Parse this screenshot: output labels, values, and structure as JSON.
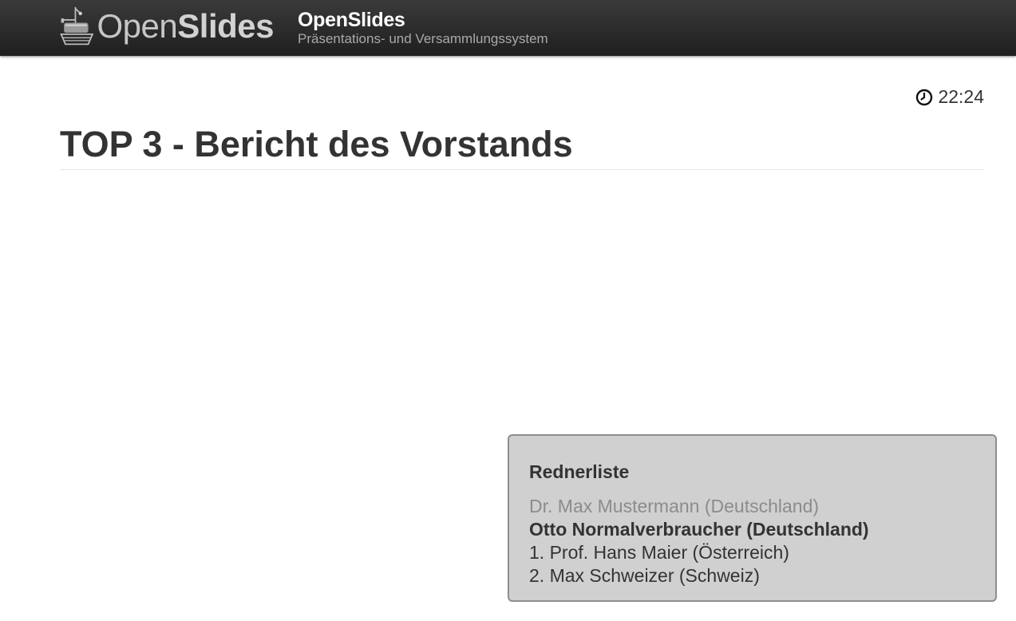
{
  "header": {
    "logo_text_light": "Open",
    "logo_text_bold": "Slides",
    "title": "OpenSlides",
    "subtitle": "Präsentations- und Versammlungssystem"
  },
  "clock": {
    "icon": "clock-icon",
    "time": "22:24"
  },
  "slide": {
    "title": "TOP 3 - Bericht des Vorstands"
  },
  "speakers": {
    "heading": "Rednerliste",
    "previous": "Dr. Max Mustermann (Deutschland)",
    "current": "Otto Normalverbraucher (Deutschland)",
    "upcoming": [
      "1. Prof. Hans Maier (Österreich)",
      "2. Max Schweizer (Schweiz)"
    ]
  },
  "colors": {
    "header_background": "#2b2b2b",
    "speakers_box_background": "#d0d0d0",
    "speakers_box_border": "#8e8e8e",
    "text_primary": "#333333",
    "text_muted": "#8c8c8c"
  }
}
